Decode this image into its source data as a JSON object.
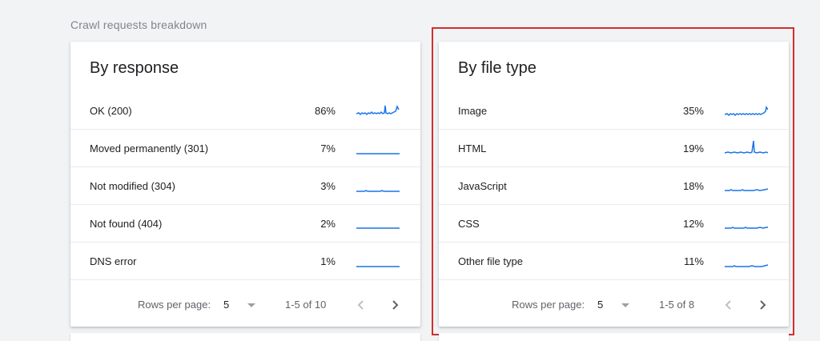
{
  "section_title": "Crawl requests breakdown",
  "accent_color": "#1a73e8",
  "highlight_color": "#d32f2f",
  "by_response": {
    "title": "By response",
    "rows": [
      {
        "label": "OK (200)",
        "pct": "86%",
        "trend": "spiky-rising"
      },
      {
        "label": "Moved permanently (301)",
        "pct": "7%",
        "trend": "flat"
      },
      {
        "label": "Not modified (304)",
        "pct": "3%",
        "trend": "flat"
      },
      {
        "label": "Not found (404)",
        "pct": "2%",
        "trend": "flat"
      },
      {
        "label": "DNS error",
        "pct": "1%",
        "trend": "flat"
      }
    ],
    "footer": {
      "rows_per_page_label": "Rows per page:",
      "rows_per_page_value": "5",
      "range": "1-5 of 10"
    }
  },
  "by_file_type": {
    "title": "By file type",
    "rows": [
      {
        "label": "Image",
        "pct": "35%",
        "trend": "rising-end"
      },
      {
        "label": "HTML",
        "pct": "19%",
        "trend": "single-spike"
      },
      {
        "label": "JavaScript",
        "pct": "18%",
        "trend": "flat"
      },
      {
        "label": "CSS",
        "pct": "12%",
        "trend": "flat"
      },
      {
        "label": "Other file type",
        "pct": "11%",
        "trend": "flat"
      }
    ],
    "footer": {
      "rows_per_page_label": "Rows per page:",
      "rows_per_page_value": "5",
      "range": "1-5 of 8"
    }
  }
}
